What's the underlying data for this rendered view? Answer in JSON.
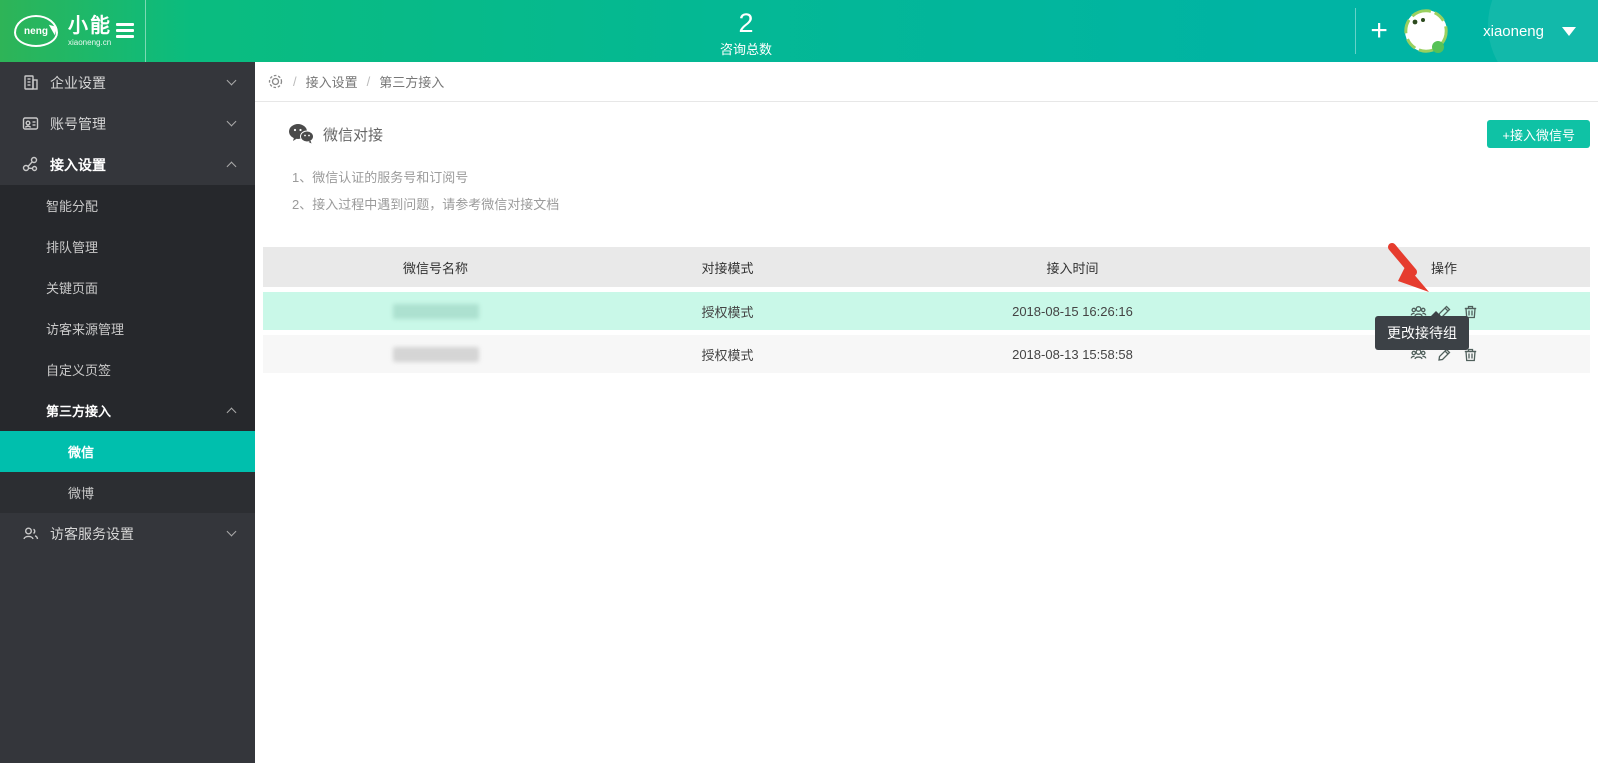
{
  "brand": {
    "logo_badge": "neng",
    "logo_text": "小能",
    "logo_sub": "xiaoneng.cn"
  },
  "topbar": {
    "stat_value": "2",
    "stat_label": "咨询总数",
    "plus_label": "+",
    "username": "xiaoneng"
  },
  "sidebar": {
    "items": [
      {
        "label": "企业设置",
        "icon": "building-icon",
        "chevron": "down",
        "level": 1
      },
      {
        "label": "账号管理",
        "icon": "id-card-icon",
        "chevron": "down",
        "level": 1
      },
      {
        "label": "接入设置",
        "icon": "share-nodes-icon",
        "chevron": "up",
        "level": 1,
        "expanded": true
      },
      {
        "label": "智能分配",
        "level": 2
      },
      {
        "label": "排队管理",
        "level": 2
      },
      {
        "label": "关键页面",
        "level": 2
      },
      {
        "label": "访客来源管理",
        "level": 2
      },
      {
        "label": "自定义页签",
        "level": 2
      },
      {
        "label": "第三方接入",
        "chevron": "up",
        "level": 2,
        "expanded": true
      },
      {
        "label": "微信",
        "level": 3,
        "active": true
      },
      {
        "label": "微博",
        "level": 3
      },
      {
        "label": "访客服务设置",
        "icon": "people-icon",
        "chevron": "down",
        "level": 1
      }
    ]
  },
  "breadcrumb": {
    "separator": "/",
    "items": [
      "接入设置",
      "第三方接入"
    ]
  },
  "main": {
    "title": "微信对接",
    "notes": [
      "1、微信认证的服务号和订阅号",
      "2、接入过程中遇到问题，请参考微信对接文档"
    ],
    "add_button": "+接入微信号",
    "table": {
      "headers": [
        "微信号名称",
        "对接模式",
        "接入时间",
        "操作"
      ],
      "rows": [
        {
          "name_redacted": true,
          "mode": "授权模式",
          "time": "2018-08-15 16:26:16",
          "highlighted": true
        },
        {
          "name_redacted": true,
          "mode": "授权模式",
          "time": "2018-08-13 15:58:58",
          "highlighted": false
        }
      ]
    },
    "tooltip": "更改接待组"
  },
  "colors": {
    "accent_teal": "#0fc2a5",
    "sidebar_active": "#00bfad",
    "row_highlight": "#c9f8e8",
    "header_gradient": [
      "#2eb457",
      "#0abc7f",
      "#00b4a4"
    ],
    "sidebar_bg": "#34363b",
    "submenu_bg": "#26282c",
    "tooltip_bg": "#3c4146",
    "annotation_red": "#e63c2e"
  }
}
